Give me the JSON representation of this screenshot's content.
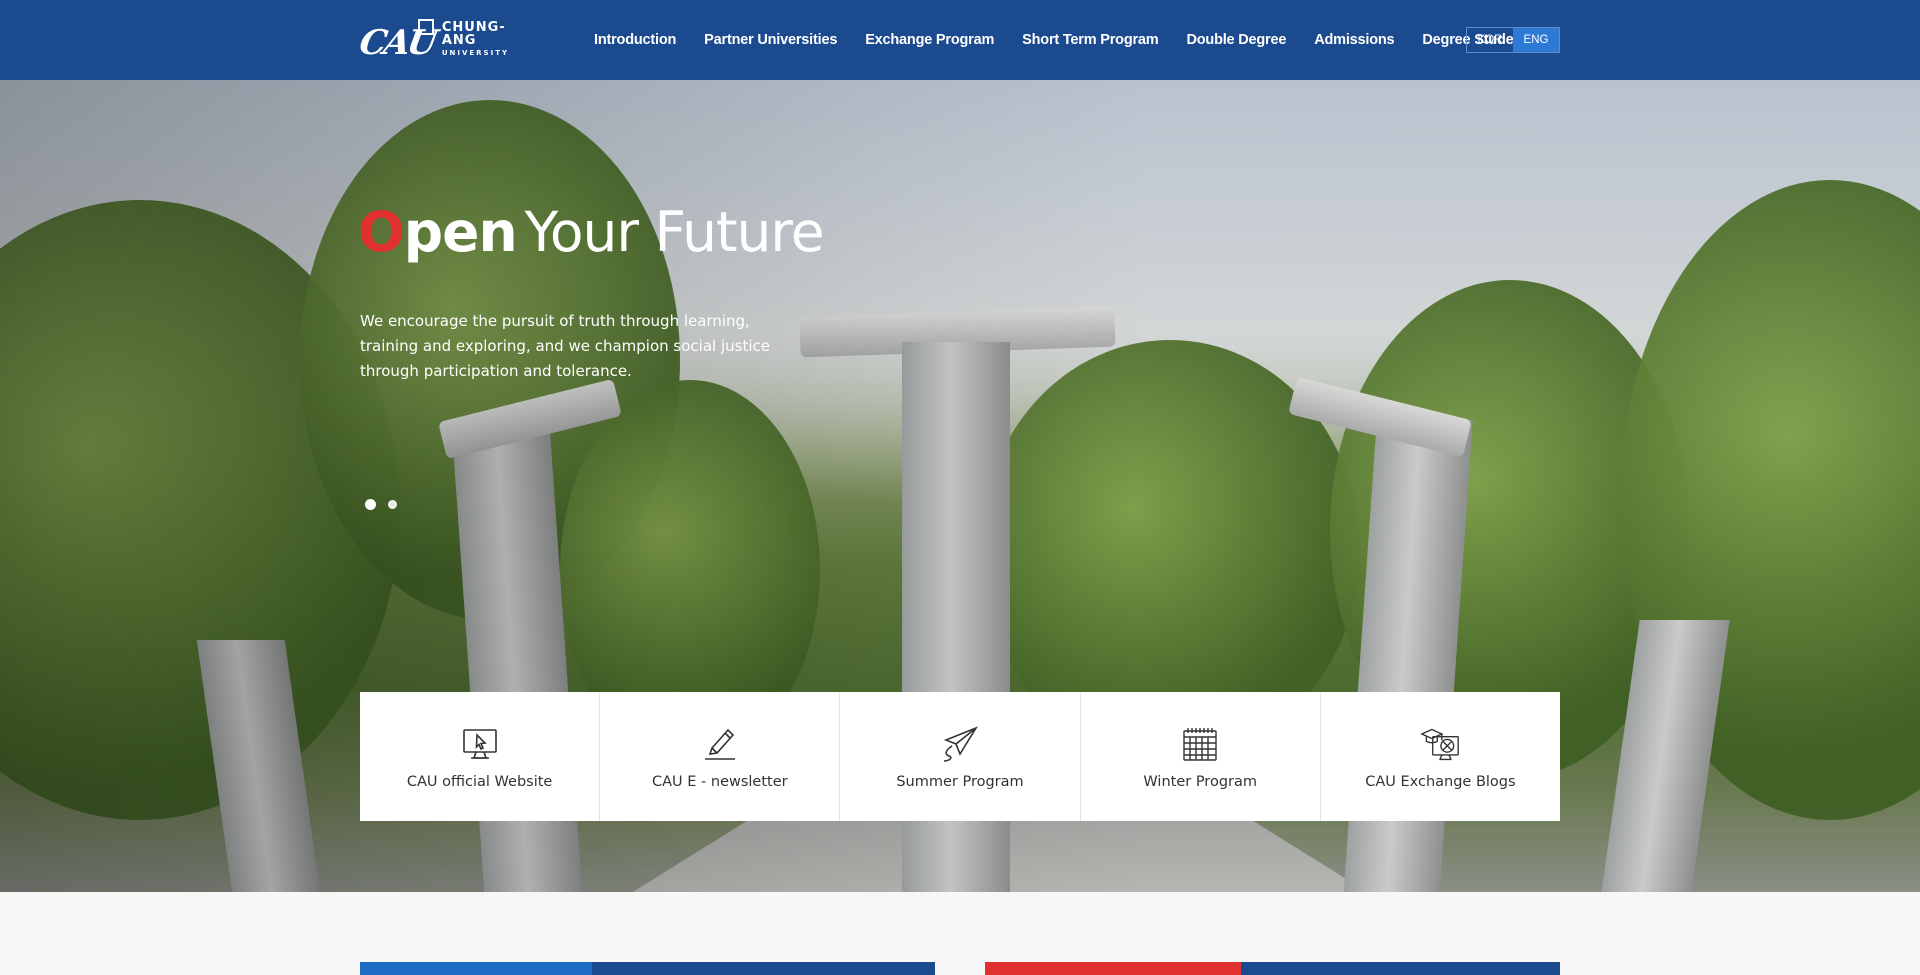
{
  "header": {
    "logo": {
      "script": "CAU",
      "line1": "CHUNG-ANG",
      "line2": "UNIVERSITY"
    },
    "nav": [
      {
        "label": "Introduction"
      },
      {
        "label": "Partner Universities"
      },
      {
        "label": "Exchange Program"
      },
      {
        "label": "Short Term Program"
      },
      {
        "label": "Double Degree"
      },
      {
        "label": "Admissions"
      },
      {
        "label": "Degree Student"
      }
    ],
    "lang": {
      "kor": "KOR",
      "eng": "ENG",
      "selected": "ENG"
    }
  },
  "hero": {
    "title_first_letter": "O",
    "title_rest_bold": "pen",
    "title_light": "Your Future",
    "description": "We encourage the pursuit of truth through learning, training and exploring, and we champion social justice through participation and tolerance.",
    "slides": {
      "count": 2,
      "active": 1
    }
  },
  "quick_links": [
    {
      "label": "CAU official Website",
      "icon": "monitor-cursor-icon"
    },
    {
      "label": "CAU E  - newsletter",
      "icon": "pencil-icon"
    },
    {
      "label": "Summer Program",
      "icon": "paper-plane-icon"
    },
    {
      "label": "Winter Program",
      "icon": "calendar-icon"
    },
    {
      "label": "CAU Exchange Blogs",
      "icon": "graduation-globe-icon"
    }
  ],
  "colors": {
    "header_bg": "#1b4a8f",
    "accent_red": "#e0312f",
    "lang_active": "#2c7ad6",
    "strip_blue_light": "#1f6cc4",
    "strip_blue_dark": "#1b4a8f",
    "strip_red": "#e0312f"
  }
}
